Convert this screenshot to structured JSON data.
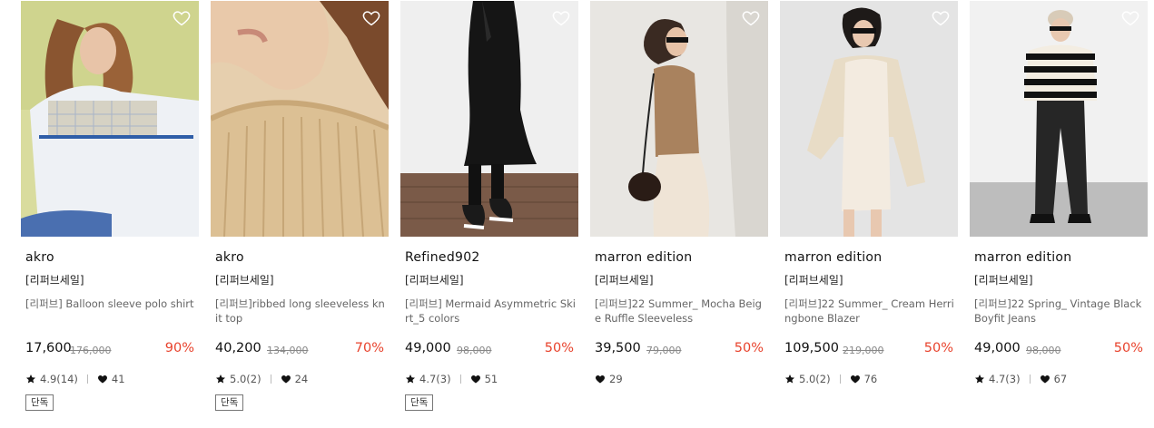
{
  "products": [
    {
      "brand": "akro",
      "tag": "[리퍼브세일]",
      "name": "[리퍼브] Balloon sleeve polo shirt",
      "price": "17,600",
      "original_price": "176,000",
      "discount": "90%",
      "rating": "4.9(14)",
      "likes": "41",
      "badge": "단독"
    },
    {
      "brand": "akro",
      "tag": "[리퍼브세일]",
      "name": "[리퍼브]ribbed long sleeveless knit top",
      "price": "40,200",
      "original_price": "134,000",
      "discount": "70%",
      "rating": "5.0(2)",
      "likes": "24",
      "badge": "단독"
    },
    {
      "brand": "Refined902",
      "tag": "[리퍼브세일]",
      "name": "[리퍼브] Mermaid Asymmetric Skirt_5 colors",
      "price": "49,000",
      "original_price": "98,000",
      "discount": "50%",
      "rating": "4.7(3)",
      "likes": "51",
      "badge": "단독"
    },
    {
      "brand": "marron edition",
      "tag": "[리퍼브세일]",
      "name": "[리퍼브]22 Summer_ Mocha Beige Ruffle Sleeveless",
      "price": "39,500",
      "original_price": "79,000",
      "discount": "50%",
      "rating": "",
      "likes": "29",
      "badge": ""
    },
    {
      "brand": "marron edition",
      "tag": "[리퍼브세일]",
      "name": "[리퍼브]22 Summer_ Cream Herringbone Blazer",
      "price": "109,500",
      "original_price": "219,000",
      "discount": "50%",
      "rating": "5.0(2)",
      "likes": "76",
      "badge": ""
    },
    {
      "brand": "marron edition",
      "tag": "[리퍼브세일]",
      "name": "[리퍼브]22 Spring_ Vintage Black Boyfit Jeans",
      "price": "49,000",
      "original_price": "98,000",
      "discount": "50%",
      "rating": "4.7(3)",
      "likes": "67",
      "badge": ""
    }
  ],
  "icons": {
    "wishlist": "heart-outline-icon",
    "rating": "star-icon",
    "likes": "heart-filled-icon"
  },
  "colors": {
    "discount": "#e8432d",
    "text": "#111111",
    "muted": "#666666"
  }
}
